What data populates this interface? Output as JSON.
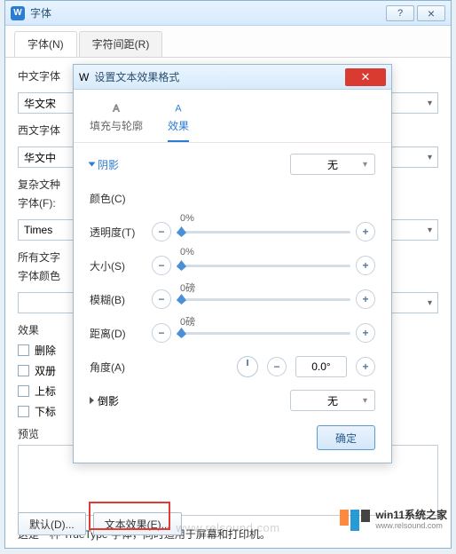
{
  "main": {
    "title": "字体",
    "tabs": {
      "font": "字体(N)",
      "spacing": "字符间距(R)"
    },
    "labels": {
      "cn_font": "中文字体",
      "cn_font_val": "华文宋",
      "en_font": "西文字体",
      "en_font_val": "华文中",
      "complex": "复杂文种",
      "font_f": "字体(F):",
      "font_f_val": "Times",
      "all_text": "所有文字",
      "font_color": "字体颜色",
      "effects": "效果",
      "strike": "删除",
      "dbl_strike": "双册",
      "super": "上标",
      "sub": "下标",
      "preview": "预览"
    },
    "note": "这是一种 TrueType 字体，同时适用于屏幕和打印机。",
    "buttons": {
      "default": "默认(D)...",
      "text_effect": "文本效果(E)..."
    }
  },
  "modal": {
    "title": "设置文本效果格式",
    "tabs": {
      "fill": "填充与轮廓",
      "effects": "效果"
    },
    "shadow": "阴影",
    "none": "无",
    "fields": {
      "color": "颜色(C)",
      "opacity": "透明度(T)",
      "size": "大小(S)",
      "blur": "模糊(B)",
      "distance": "距离(D)",
      "angle": "角度(A)"
    },
    "values": {
      "pct0": "0%",
      "pt0": "0磅",
      "angle0": "0.0°"
    },
    "reflection": "倒影",
    "ok": "确定"
  },
  "watermark": "www.relsound.com",
  "brand": {
    "line1": "win11系统之家",
    "line2": "www.relsound.com"
  }
}
